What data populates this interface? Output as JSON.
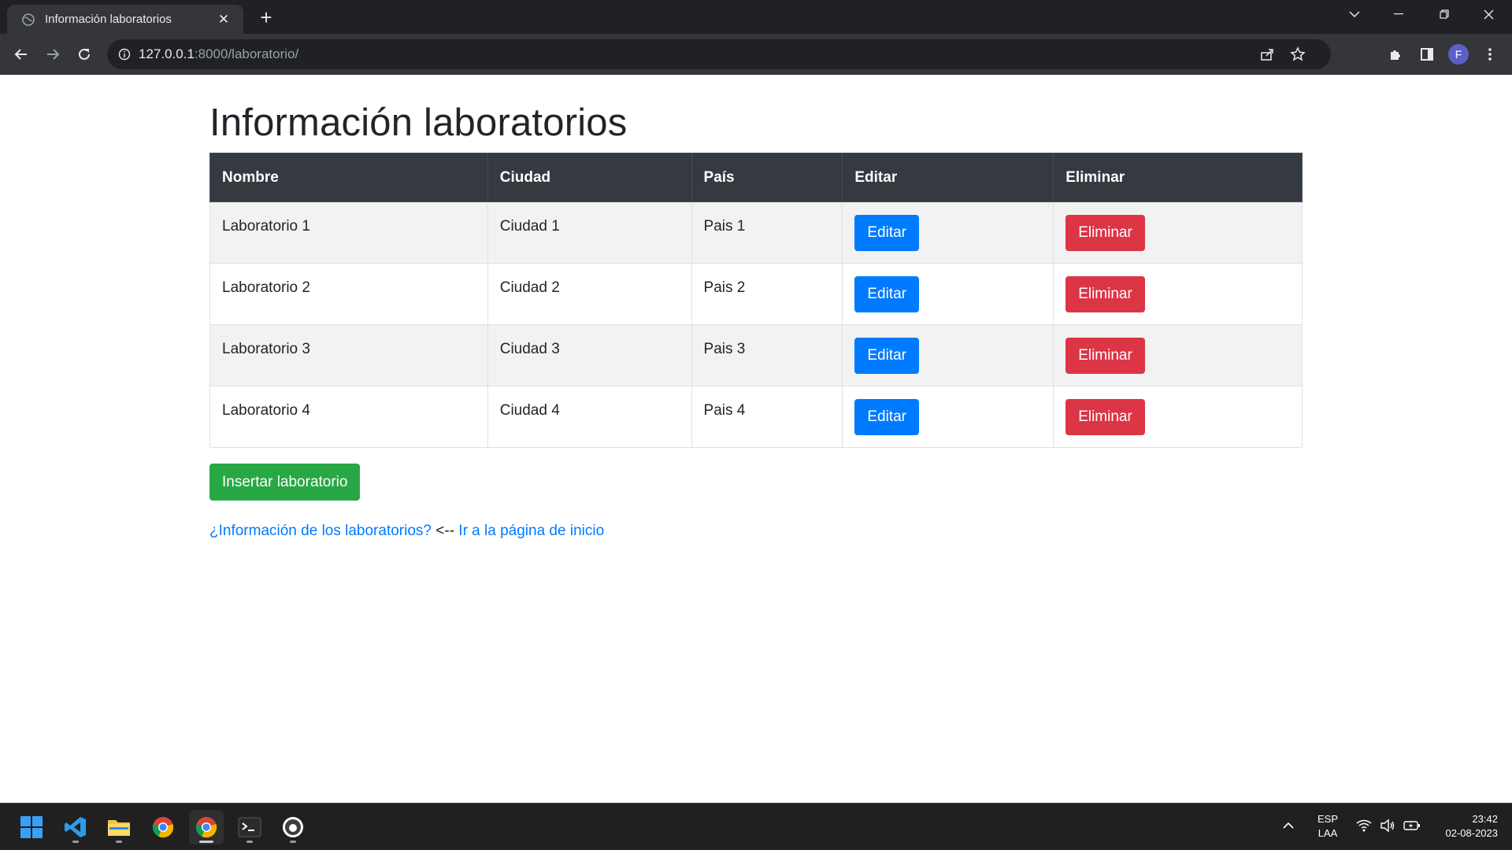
{
  "browser": {
    "tab_title": "Información laboratorios",
    "url_host": "127.0.0.1",
    "url_path": ":8000/laboratorio/",
    "profile_initial": "F"
  },
  "page": {
    "title": "Información laboratorios",
    "table": {
      "headers": [
        "Nombre",
        "Ciudad",
        "País",
        "Editar",
        "Eliminar"
      ],
      "rows": [
        {
          "nombre": "Laboratorio 1",
          "ciudad": "Ciudad 1",
          "pais": "Pais 1",
          "edit_label": "Editar",
          "delete_label": "Eliminar"
        },
        {
          "nombre": "Laboratorio 2",
          "ciudad": "Ciudad 2",
          "pais": "Pais 2",
          "edit_label": "Editar",
          "delete_label": "Eliminar"
        },
        {
          "nombre": "Laboratorio 3",
          "ciudad": "Ciudad 3",
          "pais": "Pais 3",
          "edit_label": "Editar",
          "delete_label": "Eliminar"
        },
        {
          "nombre": "Laboratorio 4",
          "ciudad": "Ciudad 4",
          "pais": "Pais 4",
          "edit_label": "Editar",
          "delete_label": "Eliminar"
        }
      ]
    },
    "insert_button": "Insertar laboratorio",
    "info_link": "¿Información de los laboratorios?",
    "separator": "<--",
    "home_link": "Ir a la página de inicio"
  },
  "taskbar": {
    "language_line1": "ESP",
    "language_line2": "LAA",
    "time": "23:42",
    "date": "02-08-2023"
  },
  "colors": {
    "primary": "#007bff",
    "danger": "#dc3545",
    "success": "#28a745",
    "table_header": "#343a40"
  }
}
